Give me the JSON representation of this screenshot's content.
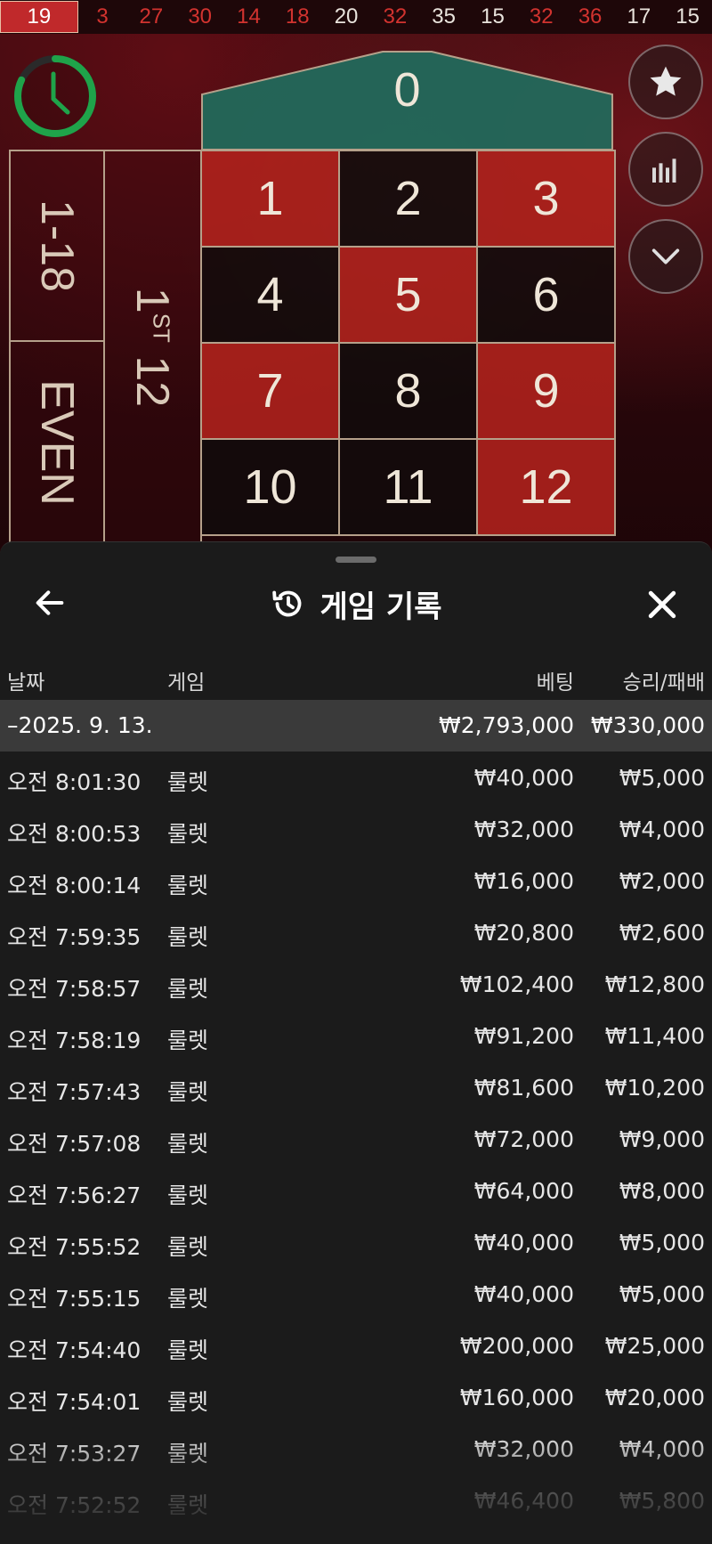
{
  "history": {
    "numbers": [
      {
        "value": "19",
        "color": "red"
      },
      {
        "value": "3",
        "color": "red"
      },
      {
        "value": "27",
        "color": "red"
      },
      {
        "value": "30",
        "color": "red"
      },
      {
        "value": "14",
        "color": "red"
      },
      {
        "value": "18",
        "color": "red"
      },
      {
        "value": "20",
        "color": "black"
      },
      {
        "value": "32",
        "color": "red"
      },
      {
        "value": "35",
        "color": "black"
      },
      {
        "value": "15",
        "color": "black"
      },
      {
        "value": "32",
        "color": "red"
      },
      {
        "value": "36",
        "color": "red"
      },
      {
        "value": "17",
        "color": "black"
      },
      {
        "value": "15",
        "color": "black"
      }
    ]
  },
  "timer": {
    "icon": "clock-icon",
    "progress": 0.82,
    "color": "#1fa34a"
  },
  "side_buttons": [
    "star-icon",
    "stats-icon",
    "chevron-down-icon"
  ],
  "table": {
    "zero": "0",
    "outside": {
      "low": "1-18",
      "even": "EVEN",
      "dozen": "1ST 12",
      "dozen_num": "1",
      "dozen_suffix": "ST",
      "dozen_rest": " 12"
    },
    "numbers": [
      {
        "n": "1",
        "color": "red"
      },
      {
        "n": "2",
        "color": "black"
      },
      {
        "n": "3",
        "color": "red"
      },
      {
        "n": "4",
        "color": "black"
      },
      {
        "n": "5",
        "color": "red"
      },
      {
        "n": "6",
        "color": "black"
      },
      {
        "n": "7",
        "color": "red"
      },
      {
        "n": "8",
        "color": "black"
      },
      {
        "n": "9",
        "color": "red"
      },
      {
        "n": "10",
        "color": "black"
      },
      {
        "n": "11",
        "color": "black"
      },
      {
        "n": "12",
        "color": "red"
      }
    ],
    "colors": {
      "red": "#b2221c",
      "black": "#120c0c",
      "zero": "#1f6e5e",
      "border": "#b5a08a"
    }
  },
  "sheet": {
    "title": "게임 기록",
    "back_icon": "arrow-left-icon",
    "title_icon": "history-icon",
    "close_icon": "close-icon",
    "headers": {
      "date": "날짜",
      "game": "게임",
      "bet": "베팅",
      "result": "승리/패배"
    },
    "summary": {
      "date": "–2025. 9. 13.",
      "bet": "₩2,793,000",
      "result": "₩330,000"
    },
    "rows": [
      {
        "time": "오전 8:01:30",
        "game": "룰렛",
        "bet": "₩40,000",
        "result": "₩5,000"
      },
      {
        "time": "오전 8:00:53",
        "game": "룰렛",
        "bet": "₩32,000",
        "result": "₩4,000"
      },
      {
        "time": "오전 8:00:14",
        "game": "룰렛",
        "bet": "₩16,000",
        "result": "₩2,000"
      },
      {
        "time": "오전 7:59:35",
        "game": "룰렛",
        "bet": "₩20,800",
        "result": "₩2,600"
      },
      {
        "time": "오전 7:58:57",
        "game": "룰렛",
        "bet": "₩102,400",
        "result": "₩12,800"
      },
      {
        "time": "오전 7:58:19",
        "game": "룰렛",
        "bet": "₩91,200",
        "result": "₩11,400"
      },
      {
        "time": "오전 7:57:43",
        "game": "룰렛",
        "bet": "₩81,600",
        "result": "₩10,200"
      },
      {
        "time": "오전 7:57:08",
        "game": "룰렛",
        "bet": "₩72,000",
        "result": "₩9,000"
      },
      {
        "time": "오전 7:56:27",
        "game": "룰렛",
        "bet": "₩64,000",
        "result": "₩8,000"
      },
      {
        "time": "오전 7:55:52",
        "game": "룰렛",
        "bet": "₩40,000",
        "result": "₩5,000"
      },
      {
        "time": "오전 7:55:15",
        "game": "룰렛",
        "bet": "₩40,000",
        "result": "₩5,000"
      },
      {
        "time": "오전 7:54:40",
        "game": "룰렛",
        "bet": "₩200,000",
        "result": "₩25,000"
      },
      {
        "time": "오전 7:54:01",
        "game": "룰렛",
        "bet": "₩160,000",
        "result": "₩20,000"
      },
      {
        "time": "오전 7:53:27",
        "game": "룰렛",
        "bet": "₩32,000",
        "result": "₩4,000"
      },
      {
        "time": "오전 7:52:52",
        "game": "룰렛",
        "bet": "₩46,400",
        "result": "₩5,800"
      }
    ]
  }
}
